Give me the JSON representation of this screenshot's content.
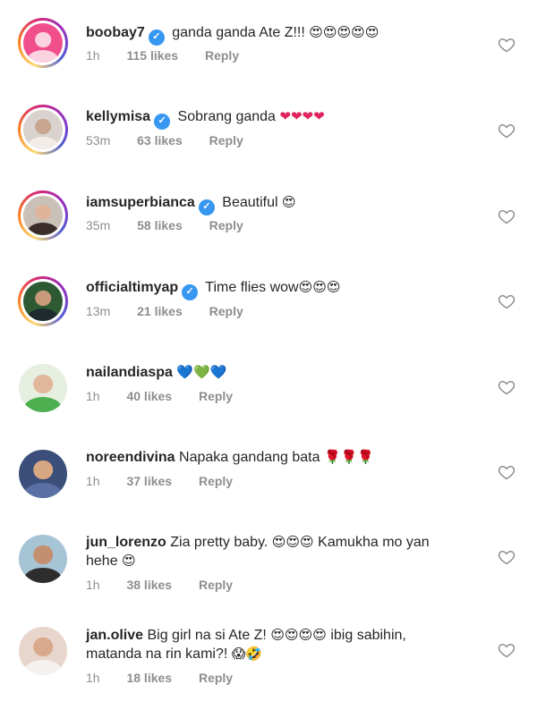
{
  "comments": [
    {
      "username": "boobay7",
      "verified": true,
      "text": "ganda ganda Ate Z!!!",
      "emoji": "😍😍😍😍😍",
      "time": "1h",
      "likes": "115 likes",
      "reply": "Reply",
      "avatar_story": true,
      "avatar_colors": {
        "bg": "#f04f8c",
        "head": "#fbd3e0",
        "body": "#fbd3e0"
      }
    },
    {
      "username": "kellymisa",
      "verified": true,
      "text": "Sobrang ganda",
      "emoji": "❤❤❤❤",
      "time": "53m",
      "likes": "63 likes",
      "reply": "Reply",
      "avatar_story": true,
      "avatar_colors": {
        "bg": "#d9d2cf",
        "head": "#c8a591",
        "body": "#f1ece8"
      }
    },
    {
      "username": "iamsuperbianca",
      "verified": true,
      "text": "Beautiful",
      "emoji": "😍",
      "time": "35m",
      "likes": "58 likes",
      "reply": "Reply",
      "avatar_story": true,
      "avatar_colors": {
        "bg": "#c9c1b8",
        "head": "#e0b39b",
        "body": "#3a2d2a"
      }
    },
    {
      "username": "officialtimyap",
      "verified": true,
      "text": "Time flies wow",
      "emoji": "😍😍😍",
      "time": "13m",
      "likes": "21 likes",
      "reply": "Reply",
      "avatar_story": true,
      "avatar_colors": {
        "bg": "#2e5a33",
        "head": "#c99a7a",
        "body": "#1f2a2f"
      }
    },
    {
      "username": "nailandiaspa",
      "verified": false,
      "text": "",
      "emoji": "💙💚💙",
      "time": "1h",
      "likes": "40 likes",
      "reply": "Reply",
      "avatar_story": false,
      "avatar_colors": {
        "bg": "#e6efe0",
        "head": "#e2b89c",
        "body": "#4caf50"
      }
    },
    {
      "username": "noreendivina",
      "verified": false,
      "text": "Napaka gandang bata",
      "emoji": "🌹🌹🌹",
      "time": "1h",
      "likes": "37 likes",
      "reply": "Reply",
      "avatar_story": false,
      "avatar_colors": {
        "bg": "#3b4f7a",
        "head": "#d7a784",
        "body": "#5a6fa3"
      }
    },
    {
      "username": "jun_lorenzo",
      "verified": false,
      "text": "Zia pretty baby.",
      "emoji": "😍😍😍",
      "text2": "Kamukha mo yan",
      "line2": "hehe",
      "emoji2": "😍",
      "time": "1h",
      "likes": "38 likes",
      "reply": "Reply",
      "avatar_story": false,
      "avatar_colors": {
        "bg": "#a7c3d6",
        "head": "#c48f6e",
        "body": "#2d2d2d"
      }
    },
    {
      "username": "jan.olive",
      "verified": false,
      "text": "Big girl na si Ate Z!",
      "emoji": "😍😍😍😍",
      "text2": "ibig sabihin,",
      "line2": "matanda na rin kami?!",
      "emoji2": "😱🤣",
      "time": "1h",
      "likes": "18 likes",
      "reply": "Reply",
      "avatar_story": false,
      "avatar_colors": {
        "bg": "#e8d6cc",
        "head": "#d8a98a",
        "body": "#f4f1ee"
      }
    }
  ],
  "icons": {
    "verified": "✓",
    "heart": "heart-outline-icon"
  },
  "colors": {
    "verified": "#3897f0",
    "meta": "#8e8e8e",
    "text": "#262626",
    "heart_stroke": "#8e8e8e"
  }
}
